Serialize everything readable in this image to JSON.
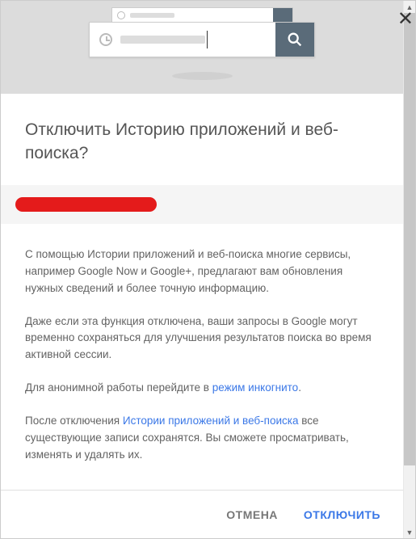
{
  "dialog": {
    "title": "Отключить Историю приложений и веб-поиска?",
    "paragraphs": {
      "p1": "С помощью Истории приложений и веб-поиска многие сервисы, например Google Now и Google+, предлагают вам обновления нужных сведений и более точную информацию.",
      "p2": "Даже если эта функция отключена, ваши запросы в Google могут временно сохраняться для улучшения результатов поиска во время активной сессии.",
      "p3_prefix": "Для анонимной работы перейдите в ",
      "p3_link": "режим инкогнито",
      "p3_suffix": ".",
      "p4_prefix": "После отключения ",
      "p4_link": "Истории приложений и веб-поиска",
      "p4_suffix": " все существующие записи сохранятся. Вы сможете просматривать, изменять и удалять их."
    },
    "buttons": {
      "cancel": "ОТМЕНА",
      "confirm": "ОТКЛЮЧИТЬ"
    }
  }
}
